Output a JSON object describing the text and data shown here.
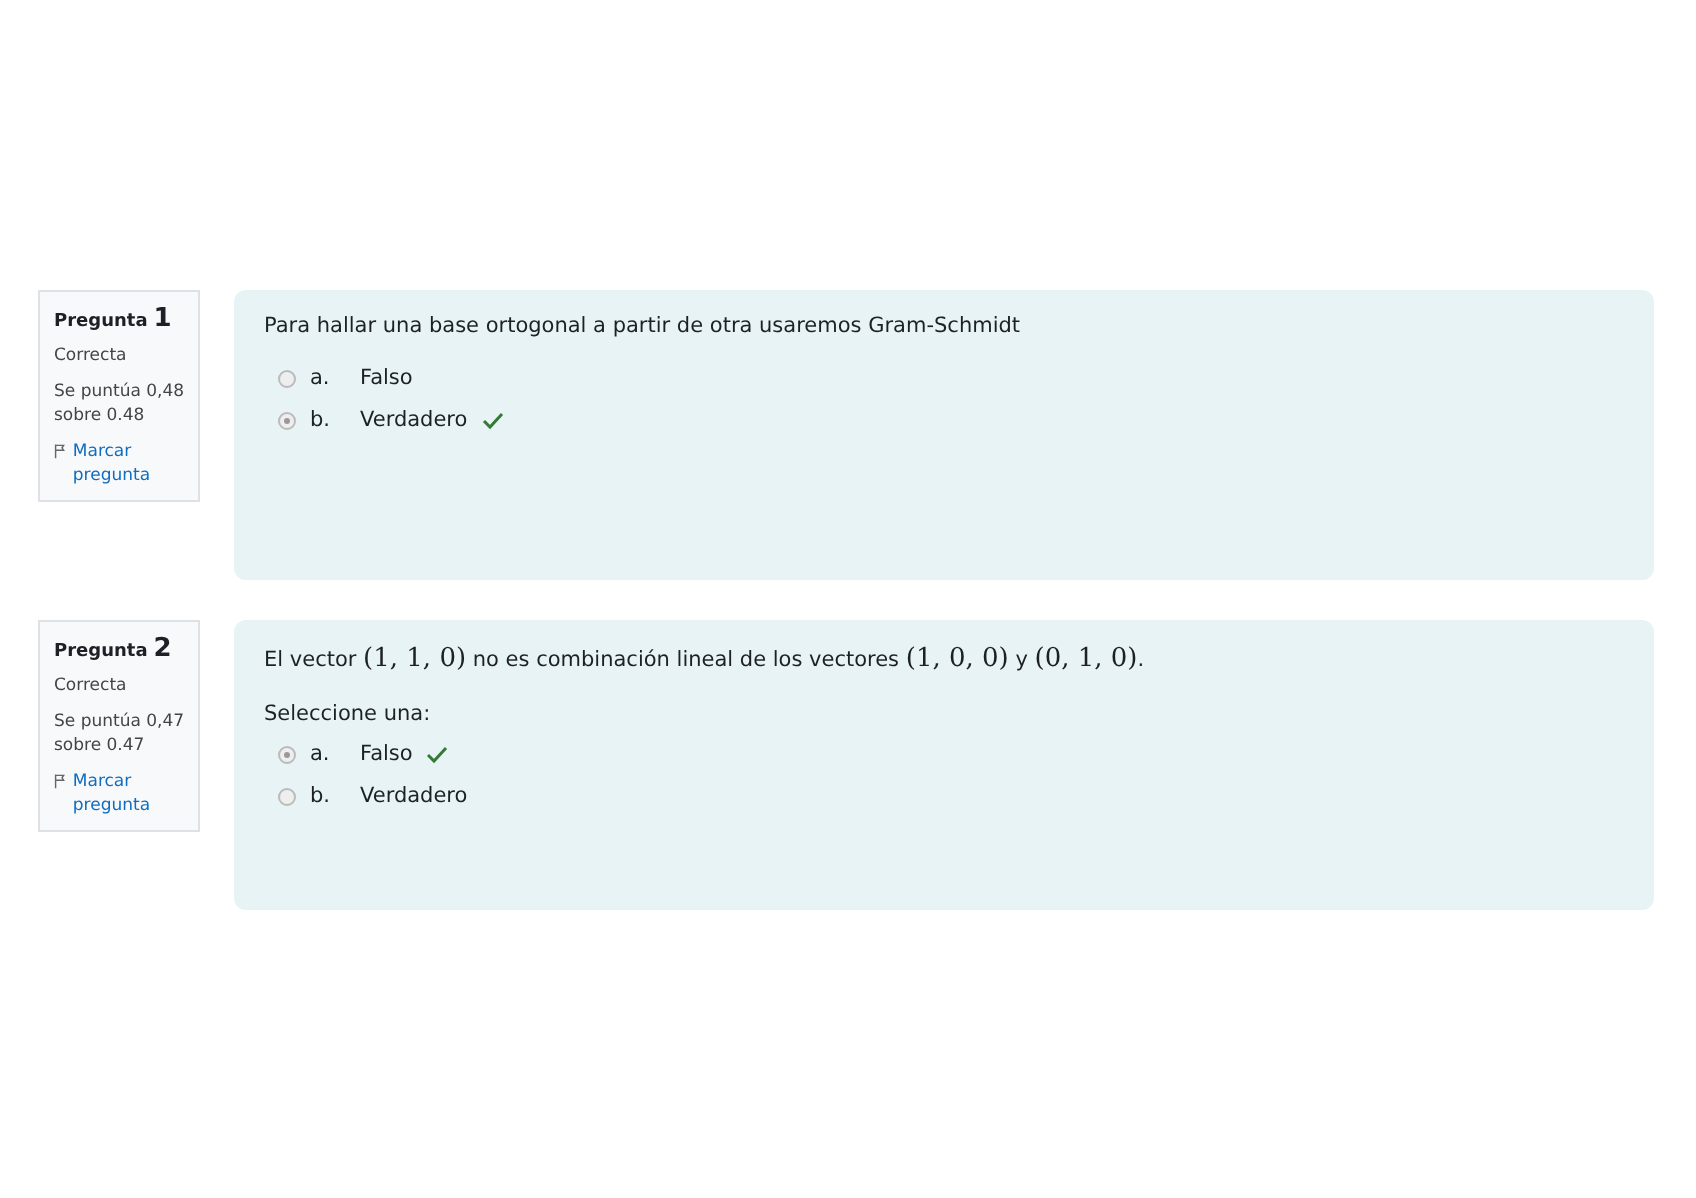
{
  "questions": [
    {
      "label": "Pregunta",
      "number": "1",
      "status": "Correcta",
      "score": "Se puntúa 0,48 sobre 0.48",
      "flag": "Marcar pregunta",
      "text": [
        {
          "kind": "text",
          "s": "Para hallar una base ortogonal a partir de otra usaremos Gram-Schmidt"
        }
      ],
      "options": [
        {
          "letter": "a.",
          "text": "Falso",
          "selected": false,
          "correct": false
        },
        {
          "letter": "b.",
          "text": "Verdadero",
          "selected": true,
          "correct": true
        }
      ]
    },
    {
      "label": "Pregunta",
      "number": "2",
      "status": "Correcta",
      "score": "Se puntúa 0,47 sobre 0.47",
      "flag": "Marcar pregunta",
      "text": [
        {
          "kind": "text",
          "s": "El vector "
        },
        {
          "kind": "math",
          "s": "(1, 1, 0)"
        },
        {
          "kind": "text",
          "s": " no es combinación lineal de los vectores "
        },
        {
          "kind": "math",
          "s": "(1, 0, 0)"
        },
        {
          "kind": "text",
          "s": " y "
        },
        {
          "kind": "math",
          "s": "(0, 1, 0)"
        },
        {
          "kind": "text",
          "s": "."
        }
      ],
      "prompt": "Seleccione una:",
      "options": [
        {
          "letter": "a.",
          "text": "Falso",
          "selected": true,
          "correct": true
        },
        {
          "letter": "b.",
          "text": "Verdadero",
          "selected": false,
          "correct": false
        }
      ]
    }
  ]
}
